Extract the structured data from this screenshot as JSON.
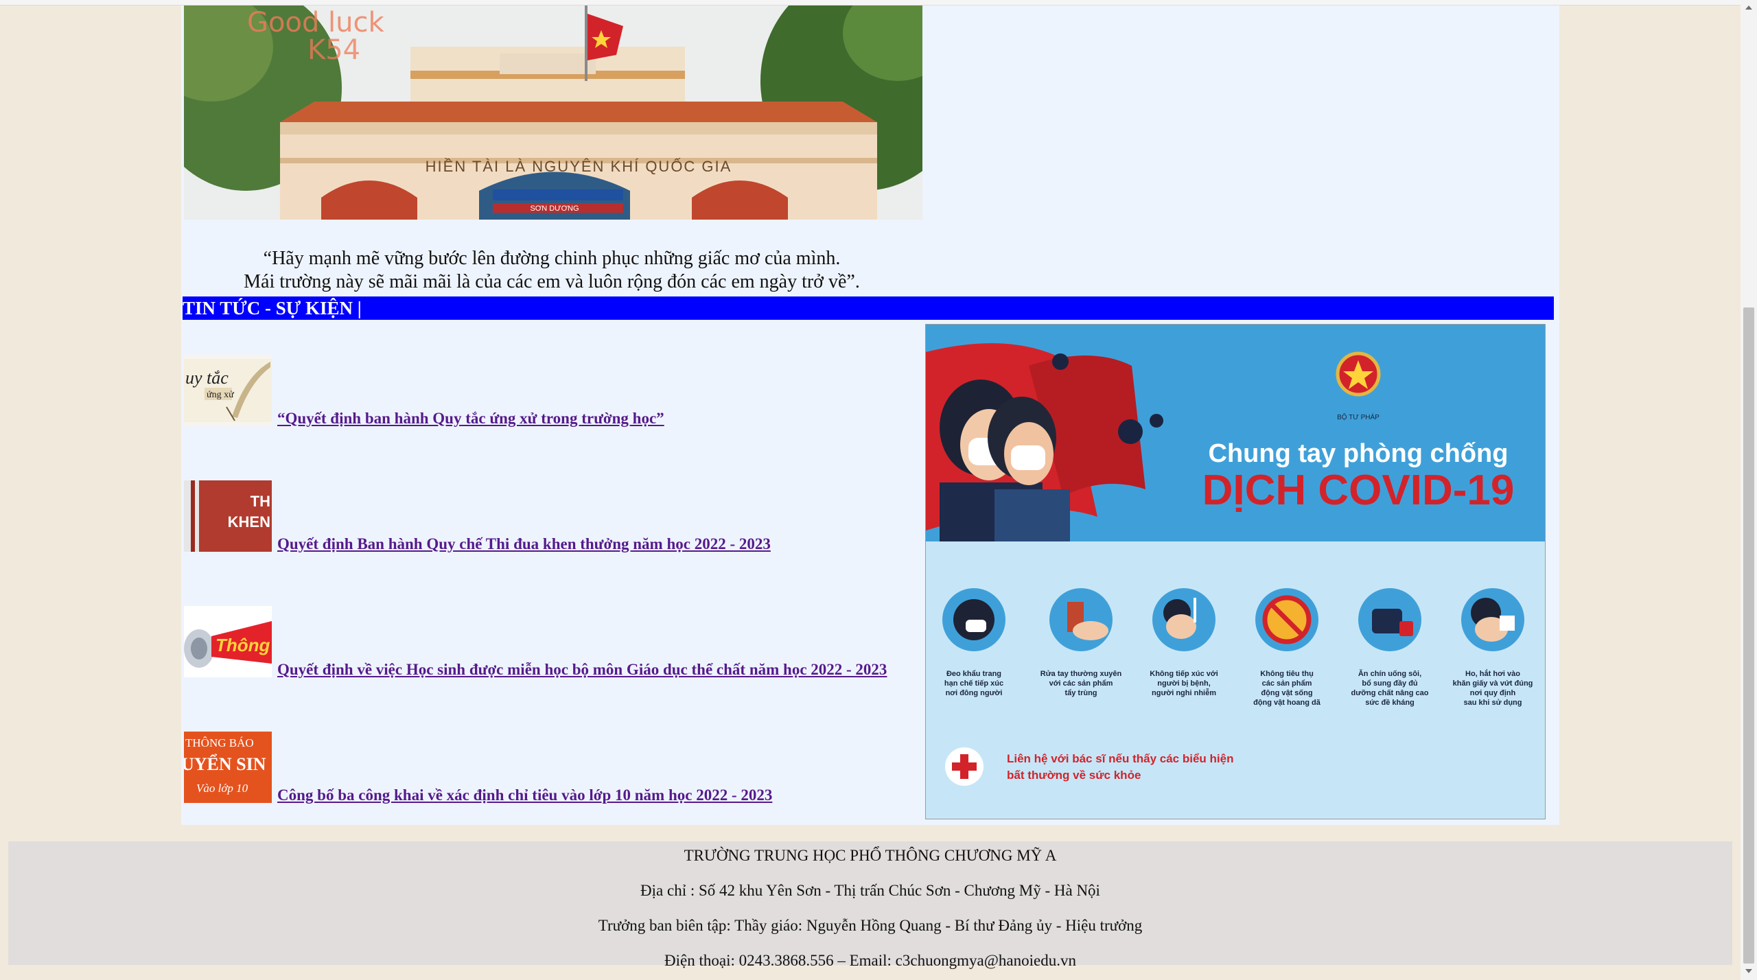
{
  "hero": {
    "overlay_text": "Good luck",
    "overlay_sub": "K54",
    "gate_inscription": "HIỀN TÀI LÀ NGUYÊN KHÍ QUỐC GIA",
    "sign_text": "SƠN DƯƠNG"
  },
  "quote": {
    "line1": "“Hãy mạnh mẽ vững bước lên đường chinh phục những giấc mơ của mình.",
    "line2": "Mái trường này sẽ mãi mãi là của các em và luôn rộng đón các em ngày trở về”."
  },
  "news_header": "TIN TỨC - SỰ KIỆN |",
  "news": [
    {
      "title": "“Quyết định ban hành Quy tắc ứng xử trong trường học”",
      "thumb_text_1": "uy tắc",
      "thumb_text_2": "ứng xử"
    },
    {
      "title": "Quyết định Ban hành Quy chế Thi đua khen thưởng năm học 2022 - 2023",
      "thumb_text_1": "TH",
      "thumb_text_2": "KHEN"
    },
    {
      "title": "Quyết định về việc Học sinh được miễn học bộ môn Giáo dục thể chất năm học 2022 - 2023",
      "thumb_text_1": "Thông b"
    },
    {
      "title": "Công bố ba công khai về xác định chỉ tiêu vào lớp 10 năm học 2022 - 2023",
      "thumb_text_1": "THÔNG BÁO",
      "thumb_text_2": "UYỂN SIN",
      "thumb_text_3": "Vào lớp 10"
    }
  ],
  "covid_poster": {
    "ministry": "BỘ TƯ PHÁP",
    "headline_1": "Chung tay phòng chống",
    "headline_2": "DỊCH COVID-19",
    "tips": [
      [
        "Đeo khẩu trang",
        "hạn chế tiếp xúc",
        "nơi đông người"
      ],
      [
        "Rửa tay thường xuyên",
        "với các sản phẩm",
        "tẩy trùng"
      ],
      [
        "Không tiếp xúc với",
        "người bị bệnh,",
        "người nghi nhiễm"
      ],
      [
        "Không tiêu thụ",
        "các sản phẩm",
        "động vật sống",
        "động vật hoang dã"
      ],
      [
        "Ăn chín uống sôi,",
        "bổ sung đầy đủ",
        "dưỡng chất nâng cao",
        "sức đề kháng"
      ],
      [
        "Ho, hắt hơi vào",
        "khăn giấy và vứt đúng",
        "nơi quy định",
        "sau khi sử dụng"
      ]
    ],
    "contact_1": "Liên hệ với bác sĩ nếu thấy các biểu hiện",
    "contact_2": "bất thường về sức khỏe"
  },
  "footer": {
    "school": "TRƯỜNG TRUNG HỌC PHỔ THÔNG CHƯƠNG MỸ A",
    "address": "Địa chỉ : Số 42 khu Yên Sơn - Thị trấn Chúc Sơn - Chương Mỹ - Hà Nội",
    "editor": "Trưởng ban biên tập: Thầy giáo: Nguyễn Hồng Quang - Bí thư Đảng ủy - Hiệu trưởng",
    "contact": "Điện thoại: 0243.3868.556 – Email: c3chuongmya@hanoiedu.vn"
  }
}
